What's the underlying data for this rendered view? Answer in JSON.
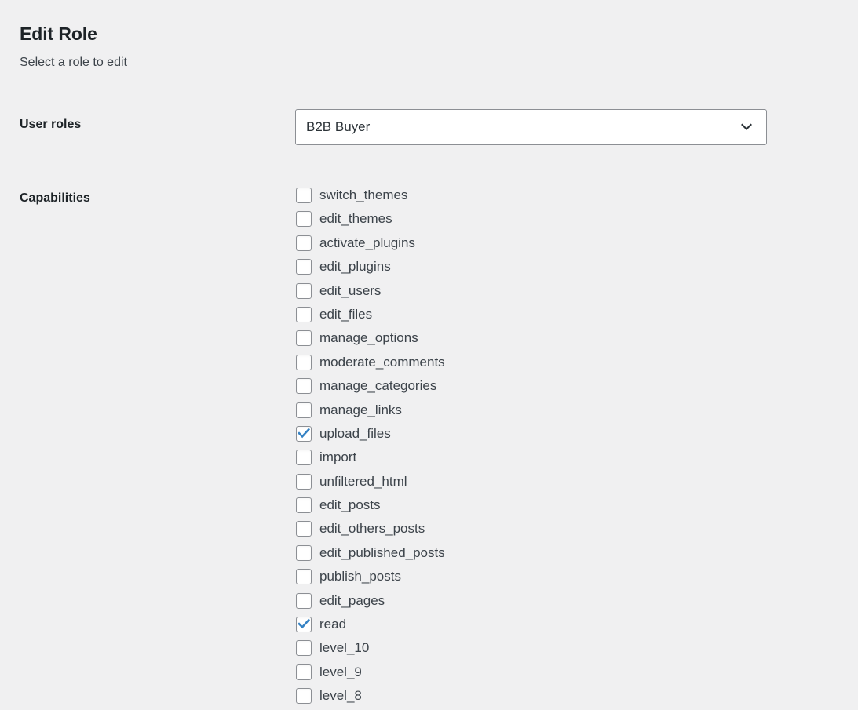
{
  "page": {
    "title": "Edit Role",
    "subtitle": "Select a role to edit"
  },
  "user_roles": {
    "label": "User roles",
    "selected": "B2B Buyer",
    "icon": "chevron-down-icon"
  },
  "capabilities": {
    "label": "Capabilities",
    "accent_color": "#3582c4",
    "items": [
      {
        "name": "switch_themes",
        "checked": false
      },
      {
        "name": "edit_themes",
        "checked": false
      },
      {
        "name": "activate_plugins",
        "checked": false
      },
      {
        "name": "edit_plugins",
        "checked": false
      },
      {
        "name": "edit_users",
        "checked": false
      },
      {
        "name": "edit_files",
        "checked": false
      },
      {
        "name": "manage_options",
        "checked": false
      },
      {
        "name": "moderate_comments",
        "checked": false
      },
      {
        "name": "manage_categories",
        "checked": false
      },
      {
        "name": "manage_links",
        "checked": false
      },
      {
        "name": "upload_files",
        "checked": true
      },
      {
        "name": "import",
        "checked": false
      },
      {
        "name": "unfiltered_html",
        "checked": false
      },
      {
        "name": "edit_posts",
        "checked": false
      },
      {
        "name": "edit_others_posts",
        "checked": false
      },
      {
        "name": "edit_published_posts",
        "checked": false
      },
      {
        "name": "publish_posts",
        "checked": false
      },
      {
        "name": "edit_pages",
        "checked": false
      },
      {
        "name": "read",
        "checked": true
      },
      {
        "name": "level_10",
        "checked": false
      },
      {
        "name": "level_9",
        "checked": false
      },
      {
        "name": "level_8",
        "checked": false
      }
    ]
  }
}
